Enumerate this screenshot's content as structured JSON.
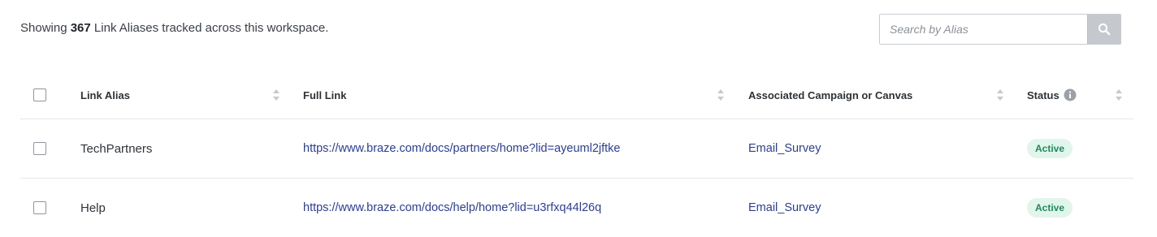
{
  "summary": {
    "prefix": "Showing",
    "count": "367",
    "suffix": "Link Aliases tracked across this workspace."
  },
  "search": {
    "placeholder": "Search by Alias",
    "icon": "search-icon"
  },
  "table": {
    "headers": {
      "alias": "Link Alias",
      "full_link": "Full Link",
      "campaign": "Associated Campaign or Canvas",
      "status": "Status"
    },
    "rows": [
      {
        "alias": "TechPartners",
        "full_link": "https://www.braze.com/docs/partners/home?lid=ayeuml2jftke",
        "campaign": "Email_Survey",
        "status": "Active"
      },
      {
        "alias": "Help",
        "full_link": "https://www.braze.com/docs/help/home?lid=u3rfxq44l26q",
        "campaign": "Email_Survey",
        "status": "Active"
      }
    ]
  },
  "colors": {
    "link": "#2c3e91",
    "badge_bg": "#e2f5ec",
    "badge_text": "#1f8a5a",
    "search_button": "#c5c9cd"
  }
}
